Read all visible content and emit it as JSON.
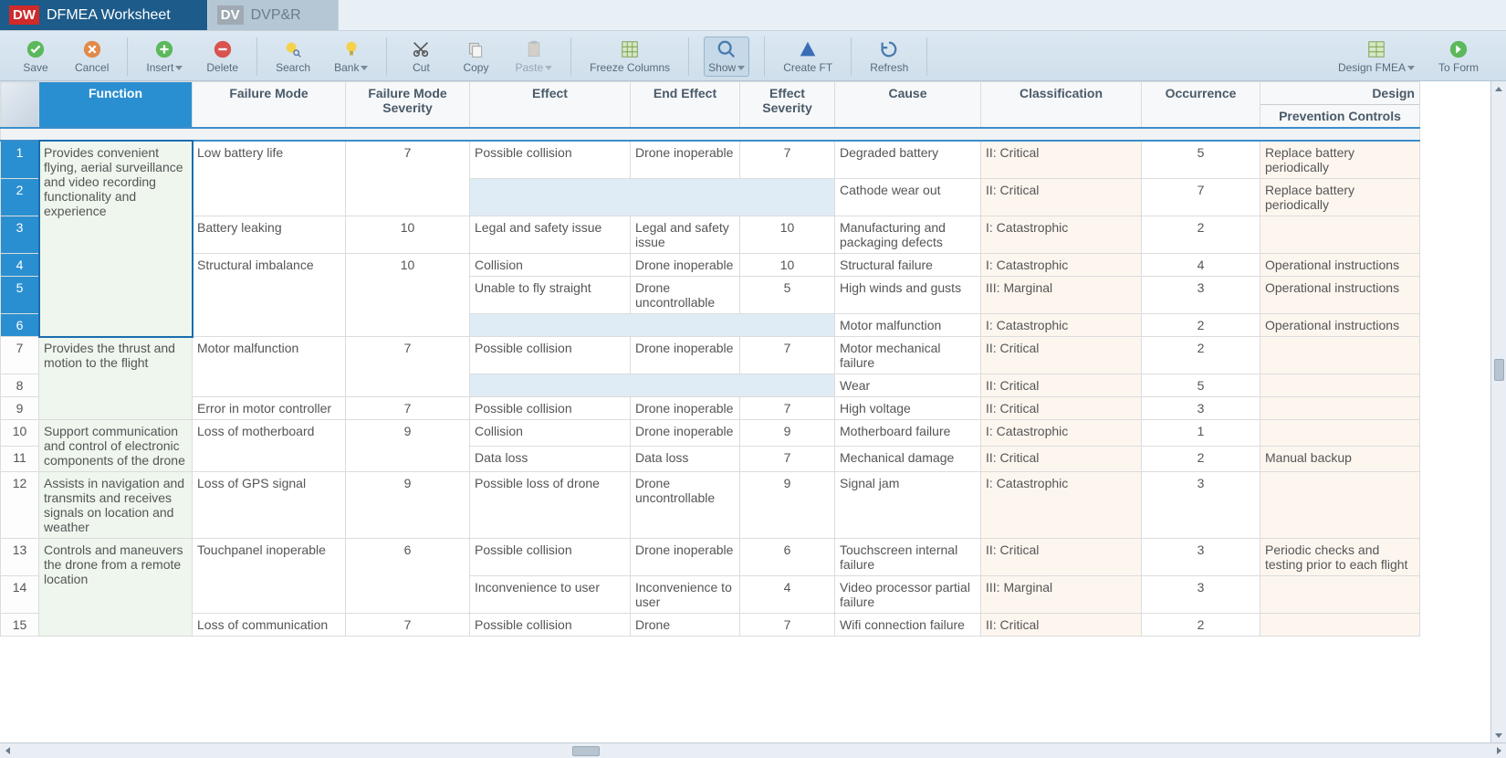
{
  "tabs": [
    {
      "badge": "DW",
      "label": "DFMEA Worksheet",
      "active": true
    },
    {
      "badge": "DV",
      "label": "DVP&R",
      "active": false
    }
  ],
  "toolbar": {
    "save": "Save",
    "cancel": "Cancel",
    "insert": "Insert",
    "delete": "Delete",
    "search": "Search",
    "bank": "Bank",
    "cut": "Cut",
    "copy": "Copy",
    "paste": "Paste",
    "freeze": "Freeze Columns",
    "show": "Show",
    "createft": "Create FT",
    "refresh": "Refresh",
    "designfmea": "Design FMEA",
    "toform": "To Form"
  },
  "columns": {
    "function": "Function",
    "failuremode": "Failure Mode",
    "fmseverity": "Failure Mode Severity",
    "effect": "Effect",
    "endeffect": "End Effect",
    "effseverity": "Effect Severity",
    "cause": "Cause",
    "classification": "Classification",
    "occurrence": "Occurrence",
    "design": "Design",
    "prevention": "Prevention Controls"
  },
  "rows": [
    {
      "n": "1",
      "fn": "Provides convenient flying, aerial surveillance and video recording functionality and experience",
      "fm": "Low battery life",
      "fms": "7",
      "eff": "Possible collision",
      "end": "Drone inoperable",
      "effs": "7",
      "cause": "Degraded battery",
      "cls": "II: Critical",
      "occ": "5",
      "prev": "Replace battery periodically",
      "sel": true,
      "fnspan": 6,
      "fmspan": 2
    },
    {
      "n": "2",
      "cause": "Cathode wear out",
      "cls": "II: Critical",
      "occ": "7",
      "prev": "Replace battery periodically",
      "sel": true,
      "blueleft": true
    },
    {
      "n": "3",
      "fm": "Battery leaking",
      "fms": "10",
      "eff": "Legal and safety issue",
      "end": "Legal and safety issue",
      "effs": "10",
      "cause": "Manufacturing and packaging defects",
      "cls": "I: Catastrophic",
      "occ": "2",
      "prev": "",
      "sel": true
    },
    {
      "n": "4",
      "fm": "Structural imbalance",
      "fms": "10",
      "eff": "Collision",
      "end": "Drone inoperable",
      "effs": "10",
      "cause": "Structural failure",
      "cls": "I: Catastrophic",
      "occ": "4",
      "prev": "Operational instructions",
      "sel": true,
      "fmspan": 3
    },
    {
      "n": "5",
      "eff": "Unable to fly straight",
      "end": "Drone uncontrollable",
      "effs": "5",
      "cause": "High winds and gusts",
      "cls": "III: Marginal",
      "occ": "3",
      "prev": "Operational instructions",
      "sel": true
    },
    {
      "n": "6",
      "cause": "Motor malfunction",
      "cls": "I: Catastrophic",
      "occ": "2",
      "prev": "Operational instructions",
      "sel": true,
      "blueleft": true
    },
    {
      "n": "7",
      "fn": "Provides the thrust and motion to the flight",
      "fm": "Motor malfunction",
      "fms": "7",
      "eff": "Possible collision",
      "end": "Drone inoperable",
      "effs": "7",
      "cause": "Motor mechanical failure",
      "cls": "II: Critical",
      "occ": "2",
      "prev": "",
      "fnspan": 3,
      "fmspan": 2
    },
    {
      "n": "8",
      "cause": "Wear",
      "cls": "II: Critical",
      "occ": "5",
      "prev": "",
      "blueleft": true
    },
    {
      "n": "9",
      "fm": "Error in motor controller",
      "fms": "7",
      "eff": "Possible collision",
      "end": "Drone inoperable",
      "effs": "7",
      "cause": "High voltage",
      "cls": "II: Critical",
      "occ": "3",
      "prev": ""
    },
    {
      "n": "10",
      "fn": "Support communication and control of electronic components of the drone",
      "fm": "Loss of motherboard",
      "fms": "9",
      "eff": "Collision",
      "end": "Drone inoperable",
      "effs": "9",
      "cause": "Motherboard failure",
      "cls": "I: Catastrophic",
      "occ": "1",
      "prev": "",
      "fnspan": 2,
      "fmspan": 2
    },
    {
      "n": "11",
      "eff": "Data loss",
      "end": "Data loss",
      "effs": "7",
      "cause": "Mechanical damage",
      "cls": "II: Critical",
      "occ": "2",
      "prev": "Manual backup"
    },
    {
      "n": "12",
      "fn": "Assists in navigation and transmits and receives signals on location and weather",
      "fm": "Loss of GPS signal",
      "fms": "9",
      "eff": "Possible loss of drone",
      "end": "Drone uncontrollable",
      "effs": "9",
      "cause": "Signal jam",
      "cls": "I: Catastrophic",
      "occ": "3",
      "prev": ""
    },
    {
      "n": "13",
      "fn": "Controls and maneuvers the drone from a remote location",
      "fm": "Touchpanel inoperable",
      "fms": "6",
      "eff": "Possible collision",
      "end": "Drone inoperable",
      "effs": "6",
      "cause": "Touchscreen internal failure",
      "cls": "II: Critical",
      "occ": "3",
      "prev": "Periodic checks and testing prior to each flight",
      "fnspan": 3,
      "fmspan": 2
    },
    {
      "n": "14",
      "eff": "Inconvenience to user",
      "end": "Inconvenience to user",
      "effs": "4",
      "cause": "Video processor partial failure",
      "cls": "III: Marginal",
      "occ": "3",
      "prev": ""
    },
    {
      "n": "15",
      "fm": "Loss of communication",
      "fms": "7",
      "eff": "Possible collision",
      "end": "Drone",
      "effs": "7",
      "cause": "Wifi connection failure",
      "cls": "II: Critical",
      "occ": "2",
      "prev": ""
    }
  ]
}
